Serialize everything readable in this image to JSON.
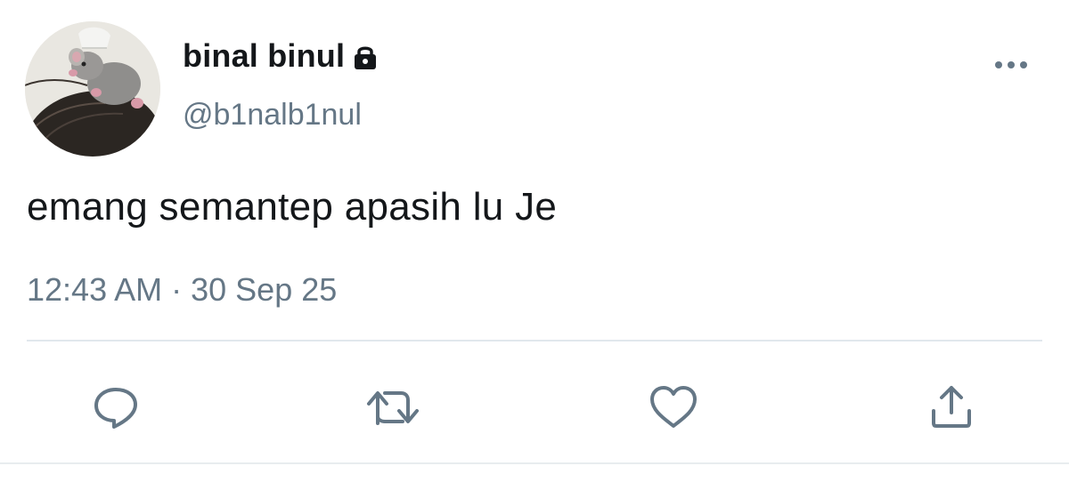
{
  "tweet": {
    "author": {
      "display_name": "binal binul",
      "handle": "@b1nalb1nul",
      "protected_icon": "lock-icon",
      "avatar": "avatar-photo"
    },
    "text": "emang semantep apasih lu Je",
    "time": "12:43 AM",
    "separator": " · ",
    "date": "30 Sep 25",
    "more_icon": "more-horizontal-icon"
  },
  "actions": [
    {
      "name": "reply",
      "icon": "reply-icon"
    },
    {
      "name": "retweet",
      "icon": "retweet-icon"
    },
    {
      "name": "like",
      "icon": "heart-icon"
    },
    {
      "name": "share",
      "icon": "share-icon"
    }
  ],
  "colors": {
    "text_primary": "#14171a",
    "text_secondary": "#657786",
    "icon": "#657786",
    "divider": "#e1e8ed"
  }
}
